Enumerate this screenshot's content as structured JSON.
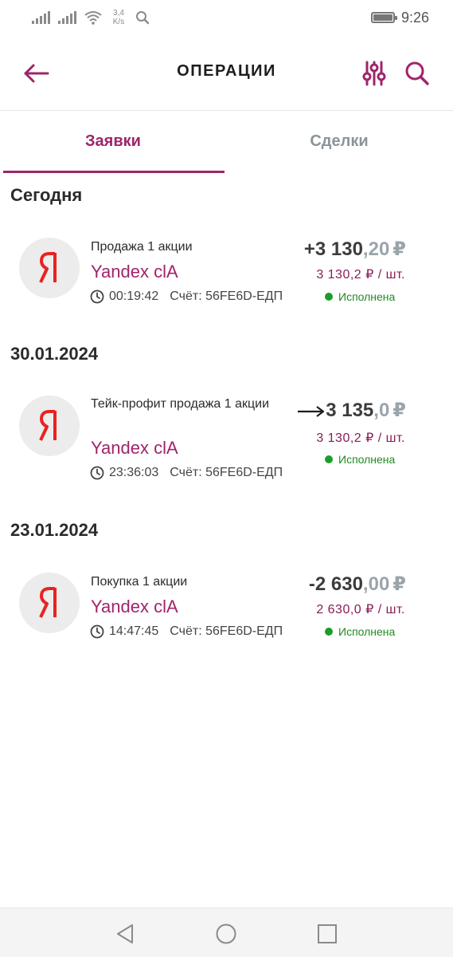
{
  "status_bar": {
    "network_speed_value": "3,4",
    "network_speed_unit": "K/s",
    "time": "9:26",
    "icons": [
      "signal-icon",
      "signal-icon",
      "wifi-icon",
      "search-icon",
      "battery-icon"
    ]
  },
  "header": {
    "title": "ОПЕРАЦИИ",
    "icons": [
      "back-arrow-icon",
      "filter-sliders-icon",
      "search-icon"
    ]
  },
  "tabs": [
    {
      "label": "Заявки",
      "active": true
    },
    {
      "label": "Сделки",
      "active": false
    }
  ],
  "sections": [
    {
      "date": "Сегодня",
      "operations": [
        {
          "type": "Продажа 1 акции",
          "name": "Yandex clA",
          "time": "00:19:42",
          "account": "Счёт: 56FE6D-ЕДП",
          "amount_int": "+3 130",
          "amount_frac": ",20",
          "currency": "₽",
          "price": "3 130,2 ₽ / шт.",
          "status": "Исполнена"
        }
      ]
    },
    {
      "date": "30.01.2024",
      "operations": [
        {
          "type": "Тейк-профит продажа 1 акции",
          "name": "Yandex clA",
          "time": "23:36:03",
          "account": "Счёт: 56FE6D-ЕДП",
          "amount_int": "3 135",
          "amount_frac": ",0",
          "currency": "₽",
          "price": "3 130,2 ₽ / шт.",
          "status": "Исполнена",
          "amount_icon": "long-right-arrow-icon"
        }
      ]
    },
    {
      "date": "23.01.2024",
      "operations": [
        {
          "type": "Покупка 1 акции",
          "name": "Yandex clA",
          "time": "14:47:45",
          "account": "Счёт: 56FE6D-ЕДП",
          "amount_int": "-2 630",
          "amount_frac": ",00",
          "currency": "₽",
          "price": "2 630,0 ₽ / шт.",
          "status": "Исполнена"
        }
      ]
    }
  ],
  "nav_bar": {
    "icons": [
      "nav-back-triangle-icon",
      "nav-home-circle-icon",
      "nav-recents-square-icon"
    ]
  },
  "colors": {
    "accent": "#a0246b",
    "price": "#8a1c57",
    "status_ok": "#1a9e2a",
    "inactive_tab": "#8a9599",
    "logo_red": "#e8231f"
  }
}
